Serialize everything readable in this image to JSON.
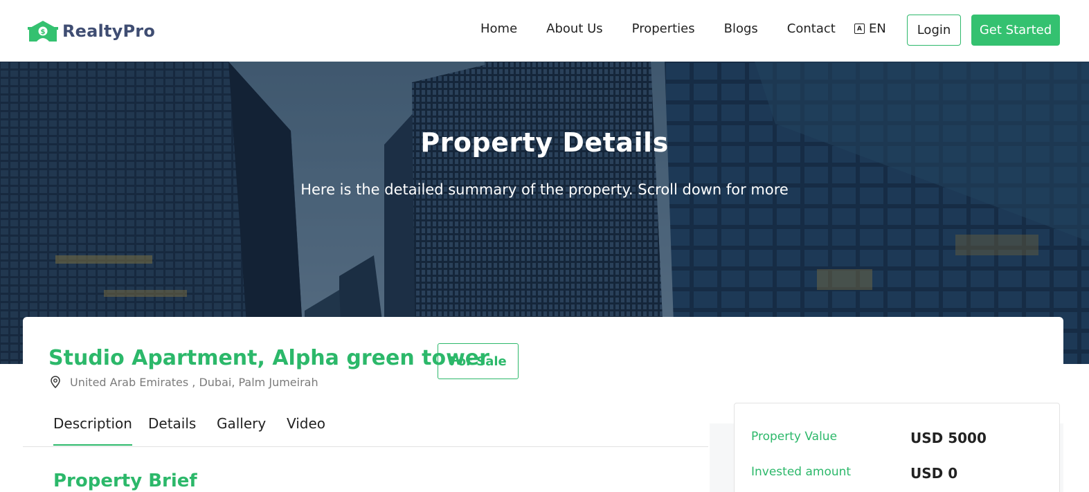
{
  "brand": {
    "name": "RealtyPro",
    "accent": "#34c170",
    "text_color": "#3f4d72"
  },
  "nav": {
    "links": [
      "Home",
      "About Us",
      "Properties",
      "Blogs",
      "Contact"
    ],
    "language": "EN",
    "login_label": "Login",
    "get_started_label": "Get Started"
  },
  "hero": {
    "title": "Property Details",
    "subtitle": "Here is the detailed summary of the property. Scroll down for more"
  },
  "property": {
    "title": "Studio Apartment, Alpha green tower",
    "status": "For Sale",
    "location": "United Arab Emirates , Dubai, Palm Jumeirah"
  },
  "tabs": [
    "Description",
    "Details",
    "Gallery",
    "Video"
  ],
  "active_tab": "Description",
  "section_title": "Property Brief",
  "info": [
    {
      "label": "Property Value",
      "value": "USD 5000"
    },
    {
      "label": "Invested amount",
      "value": "USD 0"
    }
  ]
}
